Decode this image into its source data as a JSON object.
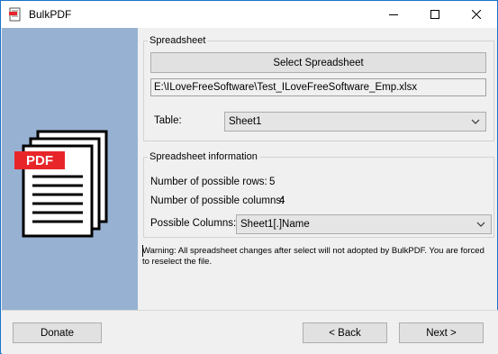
{
  "window": {
    "title": "BulkPDF"
  },
  "illustration": {
    "badge": "PDF"
  },
  "spreadsheet": {
    "legend": "Spreadsheet",
    "select_button": "Select Spreadsheet",
    "file_path": "E:\\ILoveFreeSoftware\\Test_ILoveFreeSoftware_Emp.xlsx",
    "table_label": "Table:",
    "table_value": "Sheet1"
  },
  "info": {
    "legend": "Spreadsheet information",
    "rows_label": "Number of possible rows:",
    "rows_value": "5",
    "columns_label": "Number of possible columns:",
    "columns_value": "4",
    "possible_columns_label": "Possible Columns:",
    "possible_columns_value": "Sheet1[.]Name"
  },
  "warning": "Warning: All spreadsheet changes after select will not adopted by BulkPDF. You are forced to reselect the file.",
  "footer": {
    "donate": "Donate",
    "back": "< Back",
    "next": "Next >"
  },
  "colors": {
    "sidebar": "#97b1d2",
    "pdf_badge": "#e8262a",
    "window_border": "#1a73c9"
  },
  "icons": [
    "app-pdf-icon",
    "minimize-icon",
    "maximize-icon",
    "close-icon",
    "chevron-down-icon",
    "pdf-documents-icon"
  ]
}
